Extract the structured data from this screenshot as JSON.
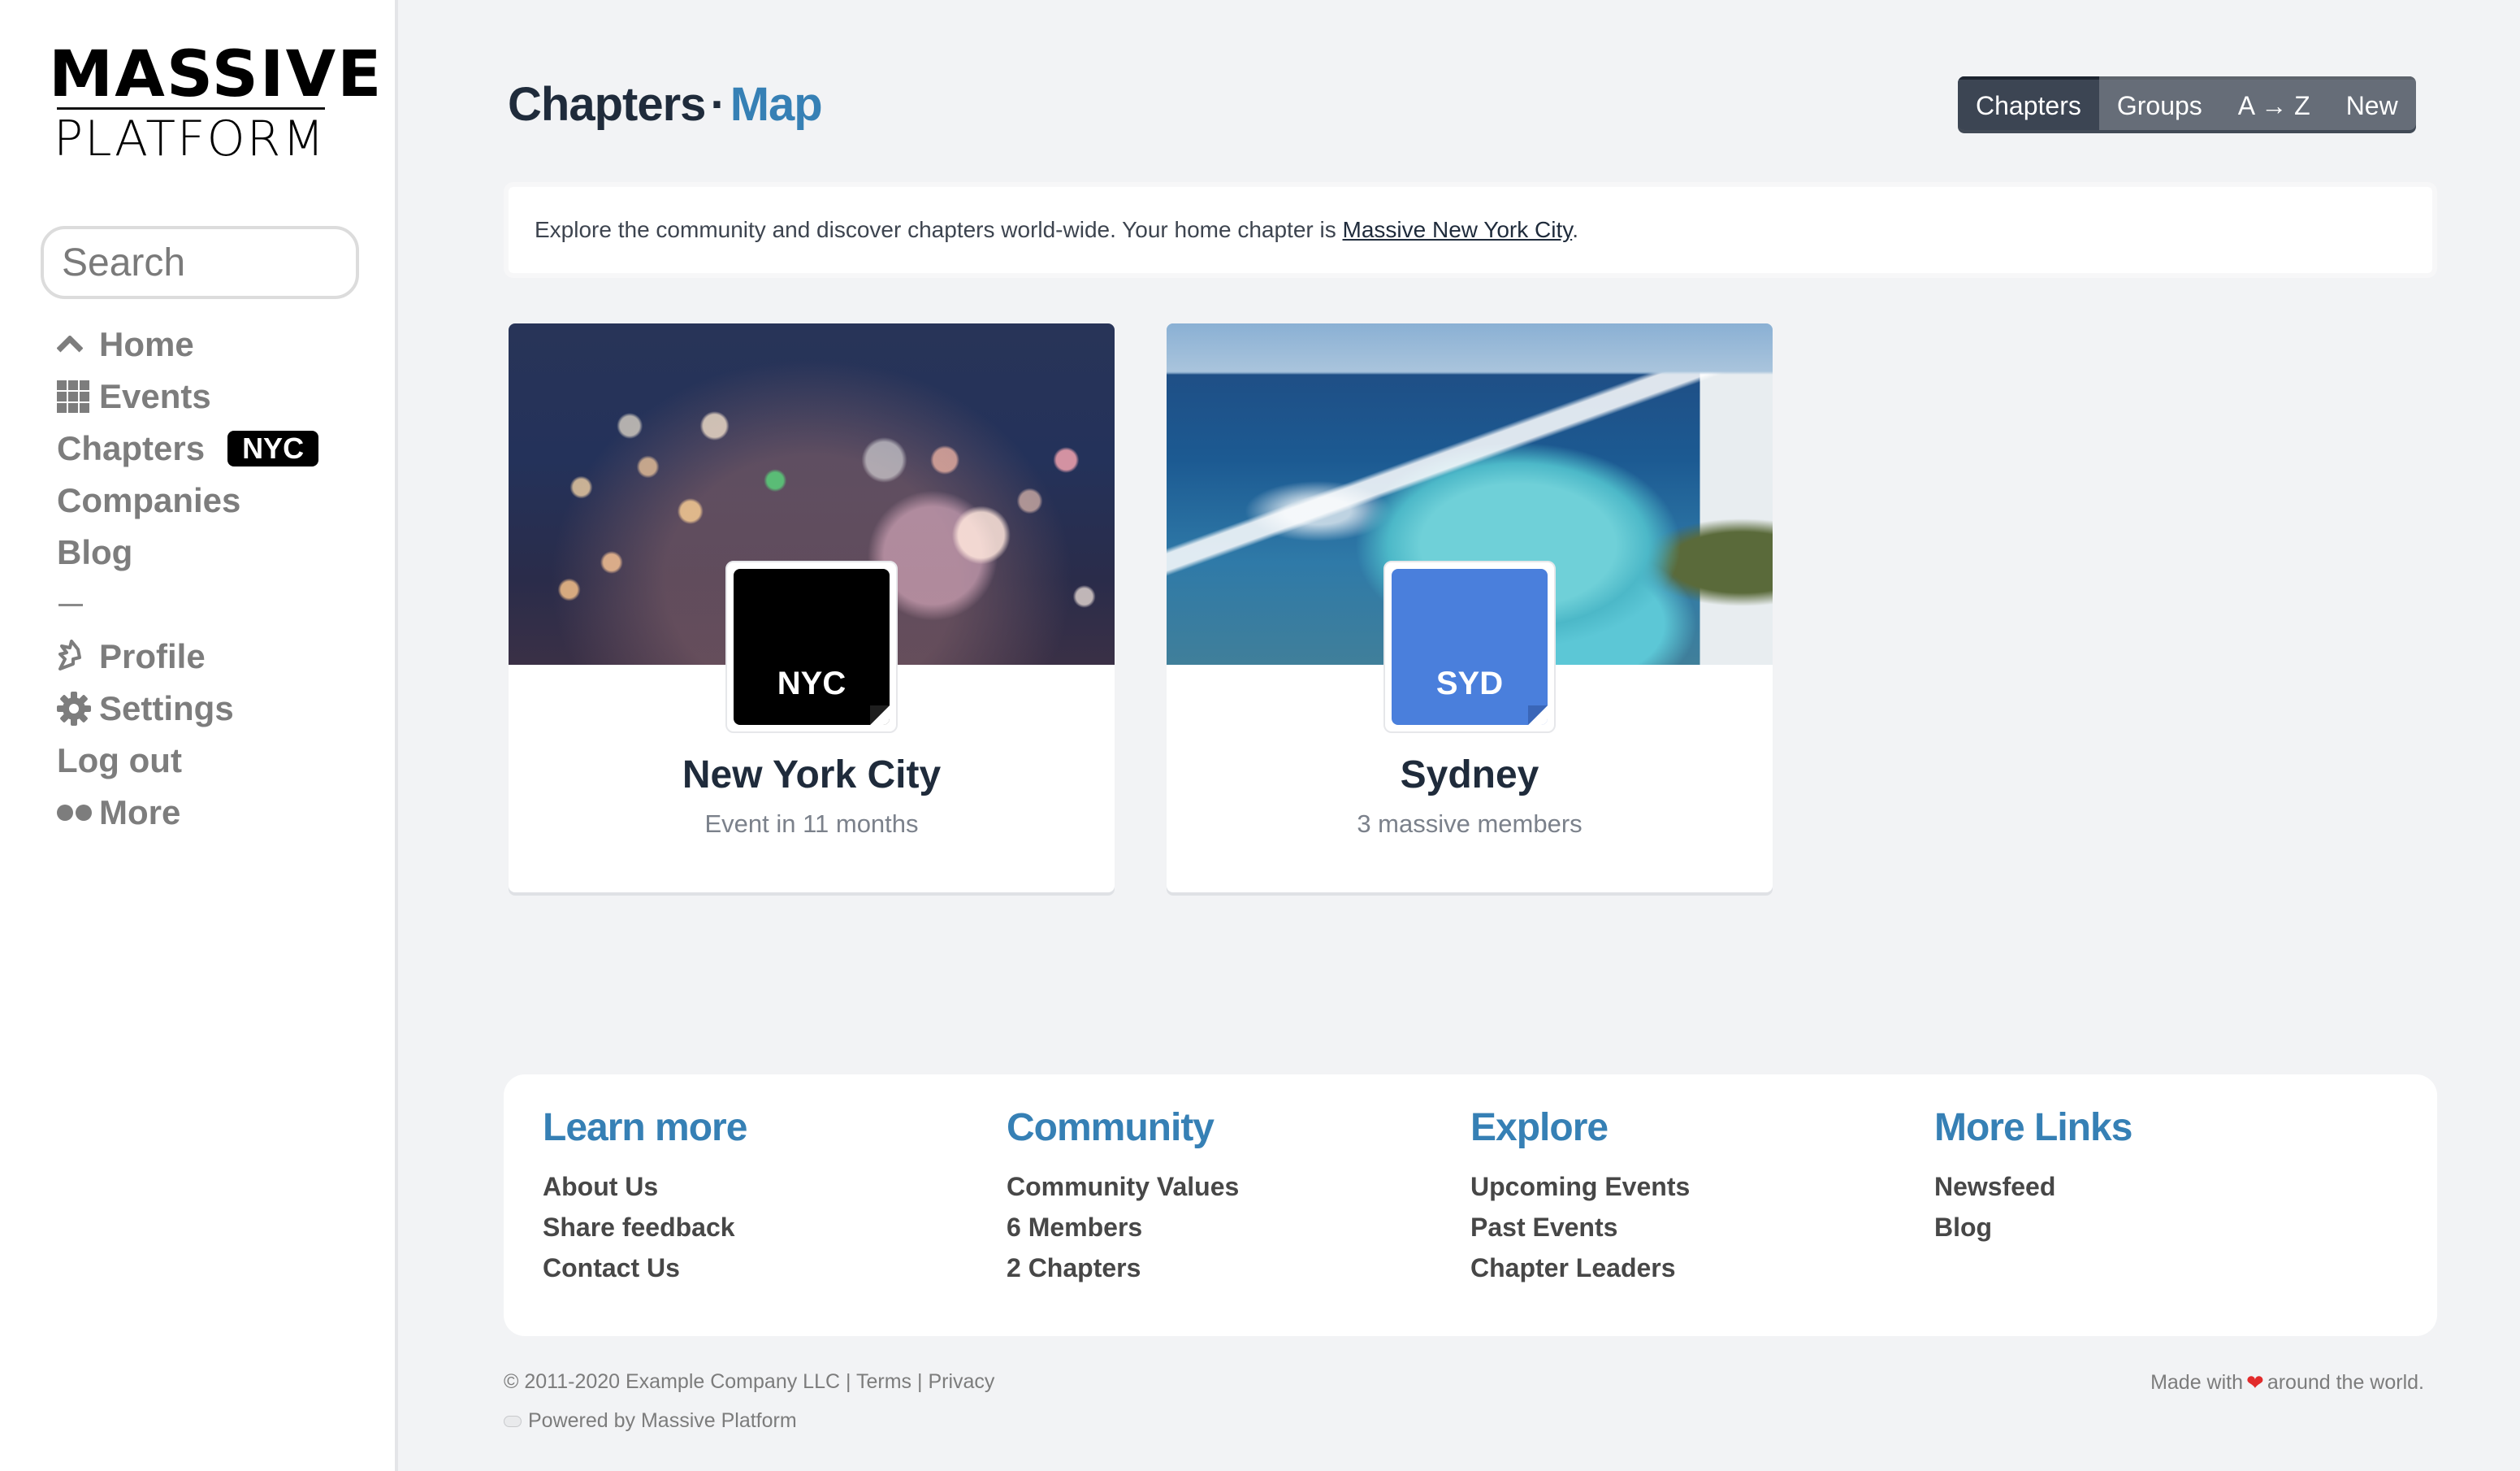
{
  "sidebar": {
    "logo_top": "MASSIVE",
    "logo_bottom": "PLATFORM",
    "search_placeholder": "Search",
    "items": [
      {
        "label": "Home",
        "icon": "chevron-up-icon"
      },
      {
        "label": "Events",
        "icon": "grid-icon"
      },
      {
        "label": "Chapters",
        "badge": "NYC"
      },
      {
        "label": "Companies"
      },
      {
        "label": "Blog"
      },
      {
        "label": "Profile",
        "icon": "profile-icon"
      },
      {
        "label": "Settings",
        "icon": "gear-icon"
      },
      {
        "label": "Log out"
      },
      {
        "label": "More",
        "icon": "dots-icon"
      }
    ]
  },
  "header": {
    "title": "Chapters",
    "separator": "·",
    "subtitle": "Map",
    "tabs": [
      {
        "label": "Chapters",
        "active": true
      },
      {
        "label": "Groups"
      },
      {
        "label": "A → Z"
      },
      {
        "label": "New"
      }
    ]
  },
  "intro": {
    "text": "Explore the community and discover chapters world-wide. Your home chapter is ",
    "link": "Massive New York City",
    "suffix": "."
  },
  "chapters": [
    {
      "code": "NYC",
      "name": "New York City",
      "subtitle": "Event in 11 months",
      "color": "#000000"
    },
    {
      "code": "SYD",
      "name": "Sydney",
      "subtitle": "3 massive members",
      "color": "#4a7fdc"
    }
  ],
  "footer": {
    "columns": [
      {
        "heading": "Learn more",
        "links": [
          "About Us",
          "Share feedback",
          "Contact Us"
        ]
      },
      {
        "heading": "Community",
        "links": [
          "Community Values",
          "6 Members",
          "2 Chapters"
        ]
      },
      {
        "heading": "Explore",
        "links": [
          "Upcoming Events",
          "Past Events",
          "Chapter Leaders"
        ]
      },
      {
        "heading": "More Links",
        "links": [
          "Newsfeed",
          "Blog"
        ]
      }
    ],
    "copyright": "© 2011-2020 Example Company LLC",
    "terms": "Terms",
    "privacy": "Privacy",
    "divider": "|",
    "powered": "Powered by Massive Platform",
    "made_prefix": "Made with",
    "heart": "❤",
    "made_suffix": "around the world."
  },
  "colors": {
    "accent": "#3680b5",
    "title": "#1f2b3b",
    "tab_active": "#3c4553",
    "tab_bg": "#666d78",
    "background": "#f2f3f5"
  }
}
